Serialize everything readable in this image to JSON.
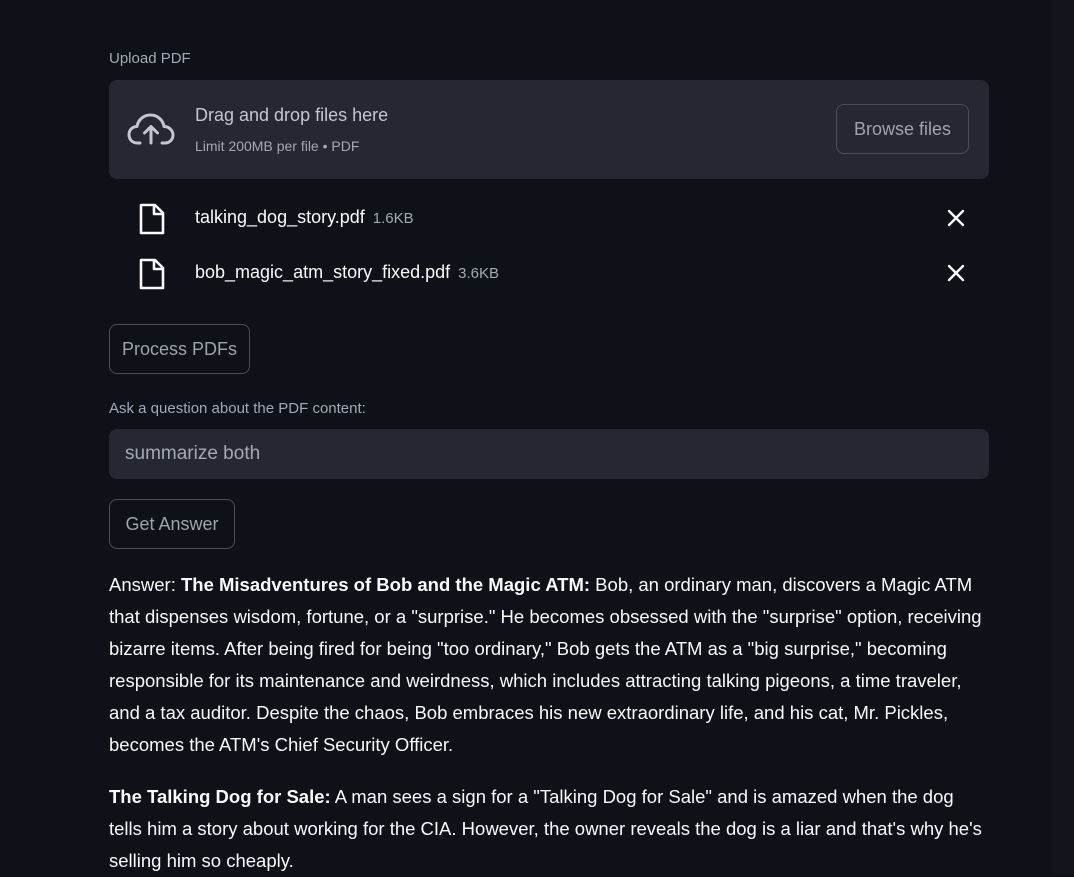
{
  "upload": {
    "label": "Upload PDF",
    "drop_title": "Drag and drop files here",
    "drop_limit": "Limit 200MB per file • PDF",
    "browse_label": "Browse files",
    "files": [
      {
        "name": "talking_dog_story.pdf",
        "size": "1.6KB"
      },
      {
        "name": "bob_magic_atm_story_fixed.pdf",
        "size": "3.6KB"
      }
    ]
  },
  "process_label": "Process PDFs",
  "question": {
    "label": "Ask a question about the PDF content:",
    "value": "summarize both"
  },
  "answer_button_label": "Get Answer",
  "answer": {
    "prefix": "Answer: ",
    "story1_title": "The Misadventures of Bob and the Magic ATM:",
    "story1_text": " Bob, an ordinary man, discovers a Magic ATM that dispenses wisdom, fortune, or a \"surprise.\" He becomes obsessed with the \"surprise\" option, receiving bizarre items. After being fired for being \"too ordinary,\" Bob gets the ATM as a \"big surprise,\" becoming responsible for its maintenance and weirdness, which includes attracting talking pigeons, a time traveler, and a tax auditor. Despite the chaos, Bob embraces his new extraordinary life, and his cat, Mr. Pickles, becomes the ATM's Chief Security Officer.",
    "story2_title": "The Talking Dog for Sale:",
    "story2_text": " A man sees a sign for a \"Talking Dog for Sale\" and is amazed when the dog tells him a story about working for the CIA. However, the owner reveals the dog is a liar and that's why he's selling him so cheaply."
  },
  "colors": {
    "background": "#0e1117",
    "panel": "#262730",
    "text": "#fafafa",
    "muted": "#a3a8b8"
  }
}
